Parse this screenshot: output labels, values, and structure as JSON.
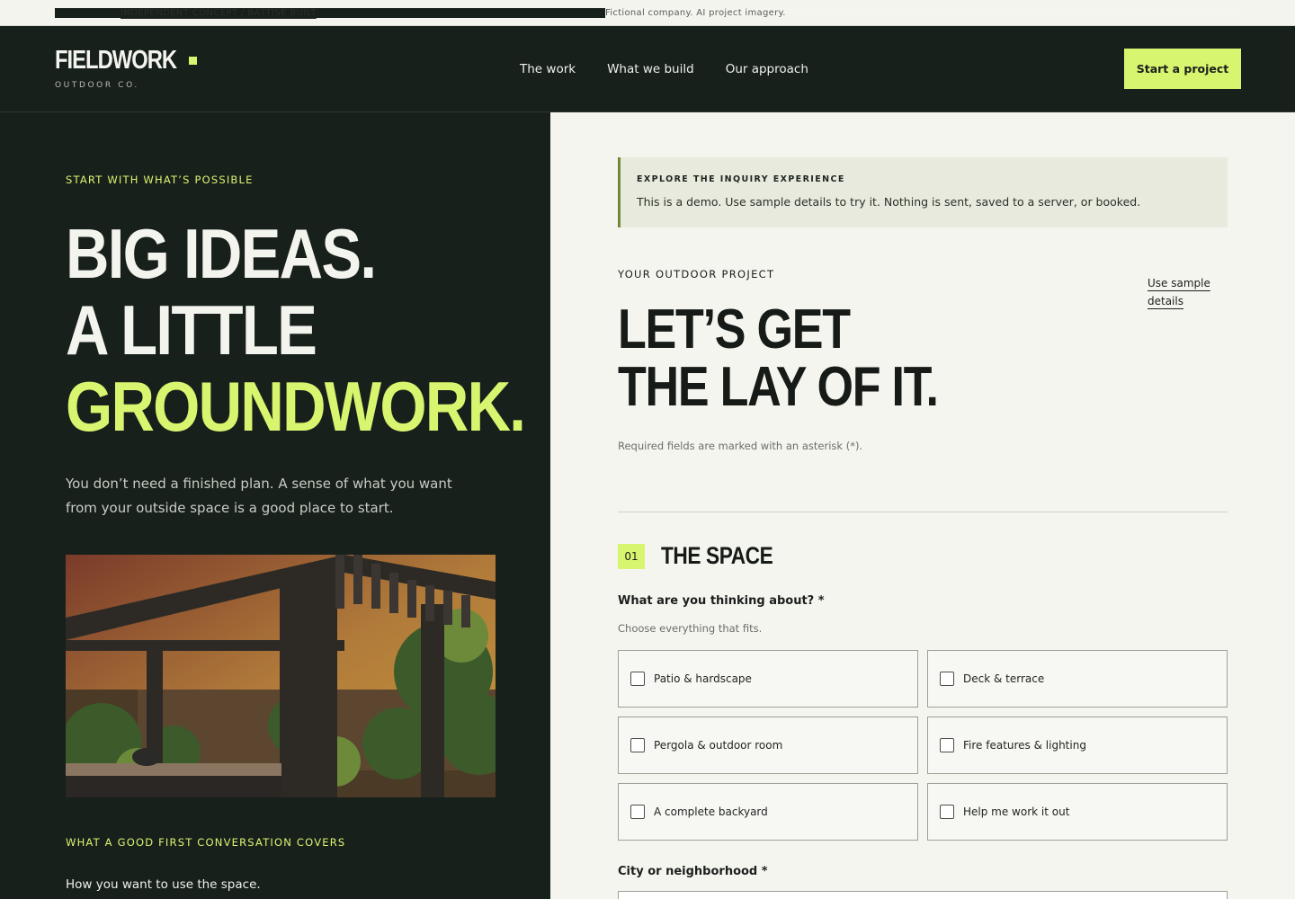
{
  "topbar": {
    "left_link": "INDEPENDENT CONCEPT / BATTISE BUILT",
    "right_note": "Fictional company. AI project imagery."
  },
  "header": {
    "logo_word": "FIELDWORK",
    "logo_sub": "OUTDOOR CO.",
    "nav": [
      "The work",
      "What we build",
      "Our approach"
    ],
    "cta": "Start a project"
  },
  "hero": {
    "eyebrow": "START WITH WHAT’S POSSIBLE",
    "line1": "BIG IDEAS.",
    "line2": "A LITTLE",
    "line3": "GROUNDWORK.",
    "lede": "You don’t need a finished plan. A sense of what you want from your outside space is a good place to start.",
    "photo_alt": "pergola-photo",
    "eyebrow2": "WHAT A GOOD FIRST CONVERSATION COVERS",
    "first_point": "How you want to use the space."
  },
  "form": {
    "demo_kicker": "EXPLORE THE INQUIRY EXPERIENCE",
    "demo_text": "This is a demo. Use sample details to try it. Nothing is sent, saved to a server, or booked.",
    "eyebrow": "YOUR OUTDOOR PROJECT",
    "sample_link": "Use sample details",
    "title_line1": "LET’S GET",
    "title_line2": "THE LAY OF IT.",
    "required_note": "Required fields are marked with an asterisk (*).",
    "step_number": "01",
    "step_title": "THE SPACE",
    "question": "What are you thinking about? *",
    "question_help": "Choose everything that fits.",
    "options": [
      "Patio & hardscape",
      "Deck & terrace",
      "Pergola & outdoor room",
      "Fire features & lighting",
      "A complete backyard",
      "Help me work it out"
    ],
    "city_label": "City or neighborhood *",
    "city_value": ""
  },
  "colors": {
    "dark": "#18201c",
    "accent": "#d8f56f",
    "paper": "#f5f5f0"
  }
}
